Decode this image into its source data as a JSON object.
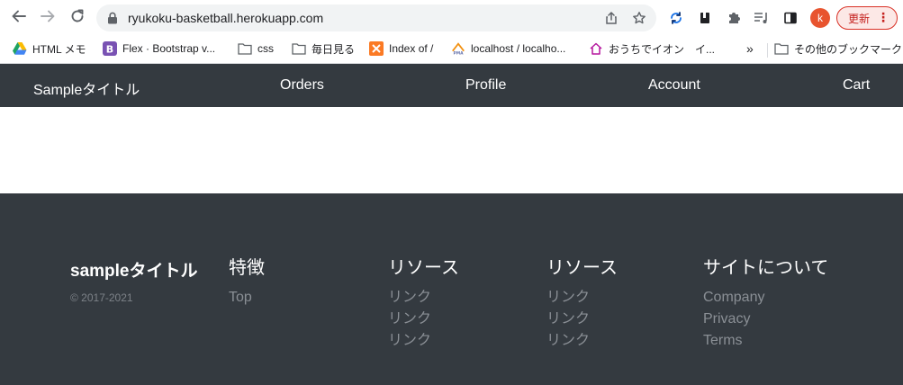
{
  "browser": {
    "url": "ryukoku-basketball.herokuapp.com",
    "avatar_letter": "k",
    "update_label": "更新",
    "bookmarks": [
      {
        "label": "HTML メモ",
        "icon": "google-drive-icon"
      },
      {
        "label": "Flex · Bootstrap v...",
        "icon": "bootstrap-icon"
      },
      {
        "label": "css",
        "icon": "folder-icon"
      },
      {
        "label": "毎日見る",
        "icon": "folder-icon"
      },
      {
        "label": "Index of /",
        "icon": "xampp-icon"
      },
      {
        "label": "localhost / localho...",
        "icon": "phpmyadmin-icon"
      },
      {
        "label": "おうちでイオン　イ...",
        "icon": "house-icon"
      }
    ],
    "overflow_label": "»",
    "other_bookmarks": "その他のブックマーク"
  },
  "navbar": {
    "brand": "Sampleタイトル",
    "links": [
      "Orders",
      "Profile",
      "Account",
      "Cart"
    ]
  },
  "footer": {
    "brand": "sampleタイトル",
    "copyright": "© 2017-2021",
    "columns": [
      {
        "heading": "特徴",
        "links": [
          "Top"
        ]
      },
      {
        "heading": "リソース",
        "links": [
          "リンク",
          "リンク",
          "リンク"
        ]
      },
      {
        "heading": "リソース",
        "links": [
          "リンク",
          "リンク",
          "リンク"
        ]
      },
      {
        "heading": "サイトについて",
        "links": [
          "Company",
          "Privacy",
          "Terms"
        ]
      }
    ]
  },
  "colors": {
    "navbar_bg": "#343a40",
    "footer_bg": "#343a40",
    "muted_text": "#8a8f95",
    "update_accent": "#d93025"
  }
}
